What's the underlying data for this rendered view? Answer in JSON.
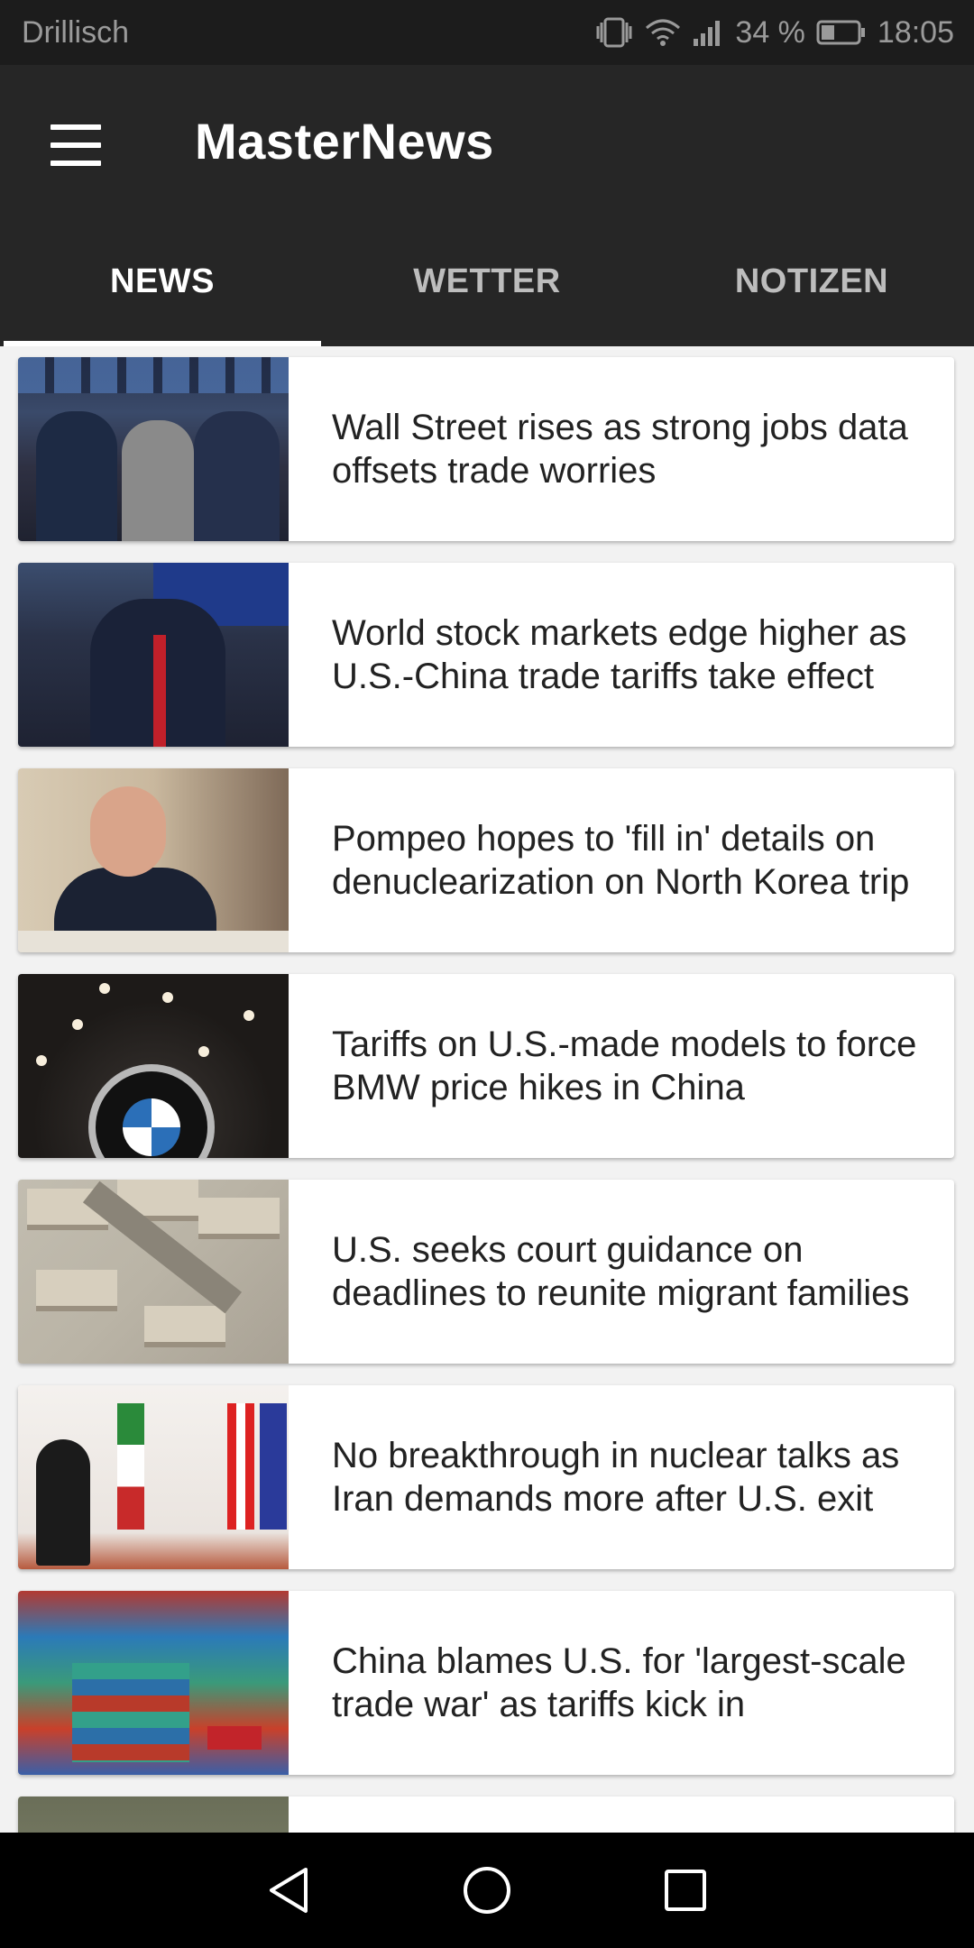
{
  "status_bar": {
    "carrier": "Drillisch",
    "battery": "34 %",
    "time": "18:05",
    "icons": [
      "vibrate-icon",
      "wifi-icon",
      "signal-icon",
      "battery-icon"
    ]
  },
  "app_bar": {
    "title": "MasterNews",
    "menu_icon": "hamburger-menu-icon"
  },
  "tabs": [
    {
      "label": "NEWS",
      "active": true
    },
    {
      "label": "WETTER",
      "active": false
    },
    {
      "label": "NOTIZEN",
      "active": false
    }
  ],
  "articles": [
    {
      "headline": "Wall Street rises as strong jobs data offsets trade worries"
    },
    {
      "headline": "World stock markets edge higher as U.S.-China trade tariffs take effect"
    },
    {
      "headline": "Pompeo hopes to 'fill in' details on denuclearization on North Korea trip"
    },
    {
      "headline": "Tariffs on U.S.-made models to force BMW price hikes in China"
    },
    {
      "headline": "U.S. seeks court guidance on deadlines to reunite migrant families"
    },
    {
      "headline": "No breakthrough in nuclear talks as Iran demands more after U.S. exit"
    },
    {
      "headline": "China blames U.S. for 'largest-scale trade war' as tariffs kick in"
    }
  ],
  "nav_bar": {
    "icons": [
      "back-icon",
      "home-icon",
      "recents-icon"
    ]
  },
  "colors": {
    "app_bar": "#262626",
    "status_bar": "#1c1c1c",
    "background": "#f2f2f2",
    "tab_indicator": "#ffffff"
  }
}
